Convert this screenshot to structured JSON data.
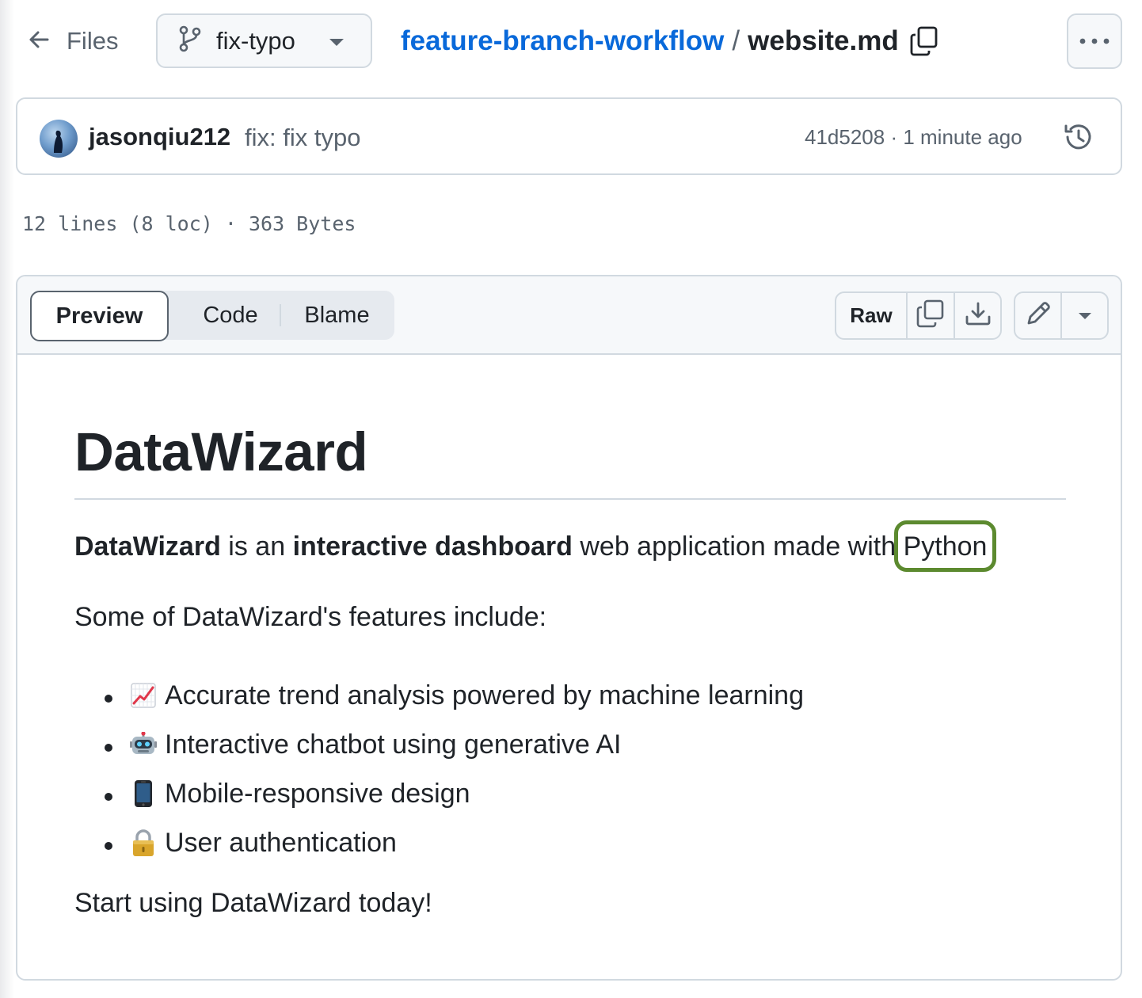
{
  "header": {
    "back_label": "Files",
    "branch": "fix-typo",
    "repo": "feature-branch-workflow",
    "separator": "/",
    "file": "website.md"
  },
  "commit": {
    "author": "jasonqiu212",
    "message": "fix: fix typo",
    "meta": "41d5208 · 1 minute ago"
  },
  "file_info": "12 lines (8 loc) · 363 Bytes",
  "view_tabs": {
    "preview": "Preview",
    "code": "Code",
    "blame": "Blame",
    "active": "Preview"
  },
  "toolbar": {
    "raw": "Raw"
  },
  "markdown": {
    "title": "DataWizard",
    "intro_bold_1": "DataWizard",
    "intro_text_1": " is an ",
    "intro_bold_2": "interactive dashboard",
    "intro_text_2": " web application made with ",
    "intro_highlight": "Python",
    "features_intro": "Some of DataWizard's features include:",
    "features": [
      {
        "icon": "chart-increasing-emoji",
        "text": "Accurate trend analysis powered by machine learning"
      },
      {
        "icon": "robot-emoji",
        "text": "Interactive chatbot using generative AI"
      },
      {
        "icon": "mobile-phone-emoji",
        "text": "Mobile-responsive design"
      },
      {
        "icon": "lock-emoji",
        "text": "User authentication"
      }
    ],
    "outro": "Start using DataWizard today!"
  },
  "colors": {
    "link": "#0969da",
    "highlight_ring": "#5c8a2f",
    "muted": "#59636e",
    "border": "#d1d9e0"
  }
}
